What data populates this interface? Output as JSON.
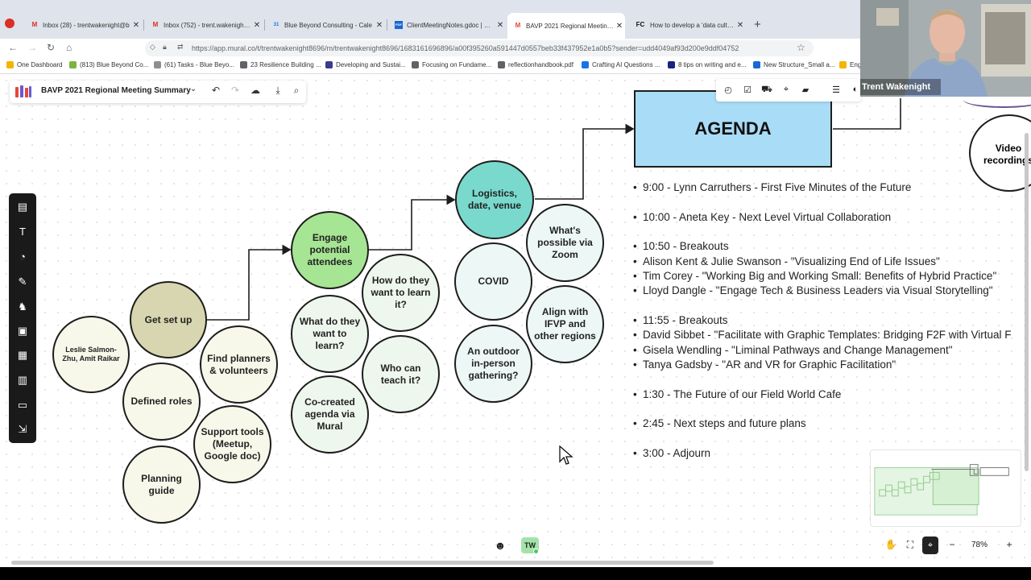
{
  "browser": {
    "tabs": [
      {
        "label": "Inbox (28) - trentwakenight@b",
        "icon": "M",
        "icon_color": "#d93025"
      },
      {
        "label": "Inbox (752) - trent.wakenight@",
        "icon": "M",
        "icon_color": "#d93025"
      },
      {
        "label": "Blue Beyond Consulting - Cale",
        "icon": "31",
        "icon_color": "#1a73e8"
      },
      {
        "label": "ClientMeetingNotes.gdoc | Pow",
        "icon": "PDF",
        "icon_color": "#1967d2"
      },
      {
        "label": "BAVP 2021 Regional Meeting S",
        "icon": "M",
        "icon_color": "#e8453c"
      },
      {
        "label": "How to develop a 'data culture",
        "icon": "FC",
        "icon_color": "#111111"
      }
    ],
    "url": "https://app.mural.co/t/trentwakenight8696/m/trentwakenight8696/1683161696896/a00f395260a591447d0557beb33f437952e1a0b5?sender=udd4049af93d200e9ddf04752",
    "bookmarks": [
      {
        "label": "One Dashboard",
        "color": "#f4b400"
      },
      {
        "label": "(813) Blue Beyond Co...",
        "color": "#7cb342"
      },
      {
        "label": "(61) Tasks - Blue Beyo...",
        "color": "#8e8e8e"
      },
      {
        "label": "23 Resilience Building ...",
        "color": "#5f6368"
      },
      {
        "label": "Developing and Sustai...",
        "color": "#3b3b8f"
      },
      {
        "label": "Focusing on Fundame...",
        "color": "#5f6368"
      },
      {
        "label": "reflectionhandbook.pdf",
        "color": "#5f6368"
      },
      {
        "label": "Crafting AI Questions ...",
        "color": "#1a73e8"
      },
      {
        "label": "8 tips on writing and e...",
        "color": "#1a237e"
      },
      {
        "label": "New Structure_Small a...",
        "color": "#1967d2"
      },
      {
        "label": "Eng",
        "color": "#f4b400"
      }
    ]
  },
  "mural": {
    "board_title": "BAVP 2021 Regional Meeting Summary",
    "zoom": "78%",
    "avatar_initials": "TW",
    "webcam_name": "Trent Wakenight"
  },
  "circles": {
    "get_set_up": "Get set up",
    "leslie": "Leslie Salmon-Zhu, Amit Raikar",
    "defined_roles": "Defined roles",
    "find_planners": "Find planners & volunteers",
    "support_tools": "Support tools (Meetup, Google doc)",
    "planning_guide": "Planning guide",
    "engage": "Engage potential attendees",
    "what_learn": "What do they want to learn?",
    "how_learn": "How do they want to learn it?",
    "who_teach": "Who can teach it?",
    "co_created": "Co-created agenda via Mural",
    "logistics": "Logistics, date, venue",
    "covid": "COVID",
    "zoom_possible": "What's possible via Zoom",
    "align_ifvp": "Align with IFVP and other regions",
    "outdoor": "An outdoor in-person gathering?",
    "video": "Video recordings"
  },
  "agenda": {
    "title": "AGENDA",
    "items": [
      "9:00 - Lynn Carruthers - First Five Minutes of the Future",
      "10:00 - Aneta Key - Next Level Virtual Collaboration",
      "10:50 - Breakouts",
      "Alison Kent & Julie Swanson - \"Visualizing End of Life Issues\"",
      "Tim Corey - \"Working Big and Working Small: Benefits of Hybrid Practice\"",
      "Lloyd Dangle - \"Engage Tech & Business Leaders via Visual Storytelling\"",
      "11:55 - Breakouts",
      "David Sibbet - \"Facilitate with Graphic Templates: Bridging F2F with Virtual F",
      "Gisela Wendling - \"Liminal Pathways and Change Management\"",
      "Tanya Gadsby - \"AR and VR for Graphic Facilitation\"",
      "1:30 - The Future of our Field World Cafe",
      "2:45 - Next steps and future plans",
      "3:00 - Adjourn"
    ]
  }
}
